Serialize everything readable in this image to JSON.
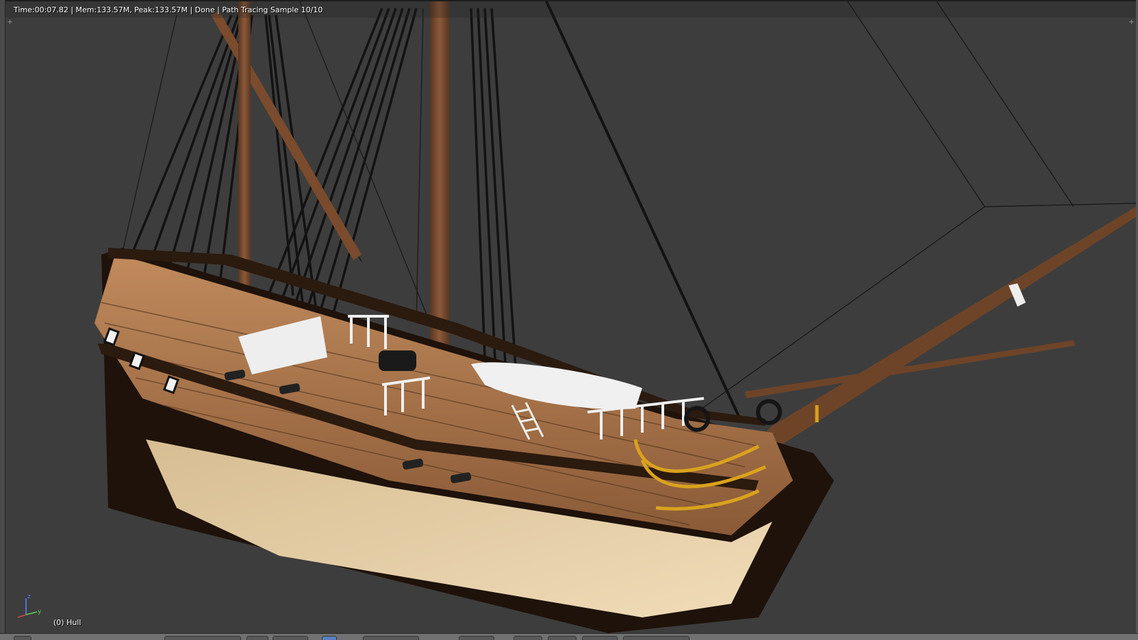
{
  "window": {
    "render_status": "Time:00:07.82 | Mem:133.57M, Peak:133.57M | Done | Path Tracing Sample 10/10",
    "active_object": "(0) Hull"
  },
  "gizmo": {
    "z_label": "z",
    "y_label": "y"
  },
  "toolbar": {
    "icons": [
      "editor-type-icon",
      "view-menu",
      "mode-dropdown",
      "shading-dropdown",
      "pivot-icon",
      "manipulator-icon",
      "layers-grid",
      "render-icon"
    ]
  },
  "colors": {
    "background": "#3d3d3d",
    "wood": "#a9774f",
    "hull_dark": "#2b1a0e",
    "hull_light": "#e6cfa6",
    "trim": "#d9a21e",
    "rigging": "#141414",
    "deck_white": "#f0f0f0"
  }
}
